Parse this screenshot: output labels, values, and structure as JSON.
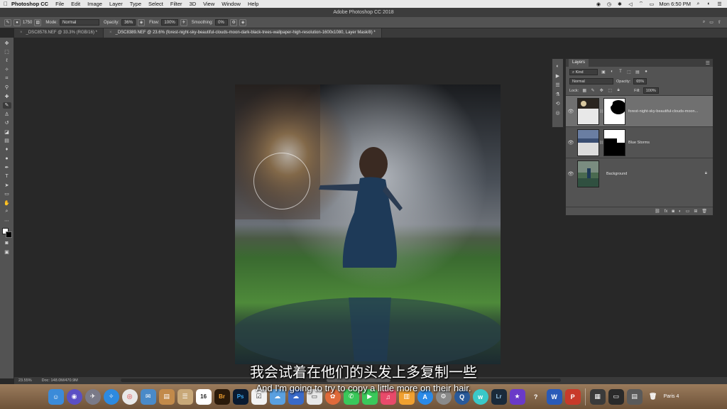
{
  "menubar": {
    "app_name": "Photoshop CC",
    "menus": [
      "File",
      "Edit",
      "Image",
      "Layer",
      "Type",
      "Select",
      "Filter",
      "3D",
      "View",
      "Window",
      "Help"
    ],
    "clock": "Mon 6:50 PM"
  },
  "window_title": "Adobe Photoshop CC 2018",
  "options": {
    "brush_size": "1750",
    "mode_label": "Mode:",
    "mode_value": "Normal",
    "opacity_label": "Opacity:",
    "opacity_value": "36%",
    "flow_label": "Flow:",
    "flow_value": "100%",
    "smoothing_label": "Smoothing:",
    "smoothing_value": "0%"
  },
  "tabs": [
    {
      "label": "_DSC8578.NEF @ 33.3% (RGB/16) *",
      "active": false
    },
    {
      "label": "_DSC8389.NEF @ 23.6% (forest-night-sky-beautiful-clouds-moon-dark-black-trees-wallpaper-high-resolution-1600x1080, Layer Mask/8) *",
      "active": true
    }
  ],
  "status": {
    "zoom": "23.55%",
    "doc": "Doc: 148.0M/470.9M"
  },
  "layers_panel": {
    "title": "Layers",
    "filter_kind": "Kind",
    "blend_mode": "Normal",
    "opacity_label": "Opacity:",
    "opacity_value": "65%",
    "lock_label": "Lock:",
    "fill_label": "Fill:",
    "fill_value": "100%",
    "layers": [
      {
        "name": "forest-night-sky-beautiful-clouds-moon...",
        "selected": true,
        "locked": false
      },
      {
        "name": "Blue Storms",
        "selected": false,
        "locked": false
      },
      {
        "name": "Background",
        "selected": false,
        "locked": true
      }
    ]
  },
  "subtitles": {
    "zh": "我会试着在他们的头发上多复制一些",
    "en": "And I'm going to try to copy a little more on their hair."
  },
  "dock": {
    "calendar_day": "16",
    "dock_badge": "Paris 4"
  }
}
